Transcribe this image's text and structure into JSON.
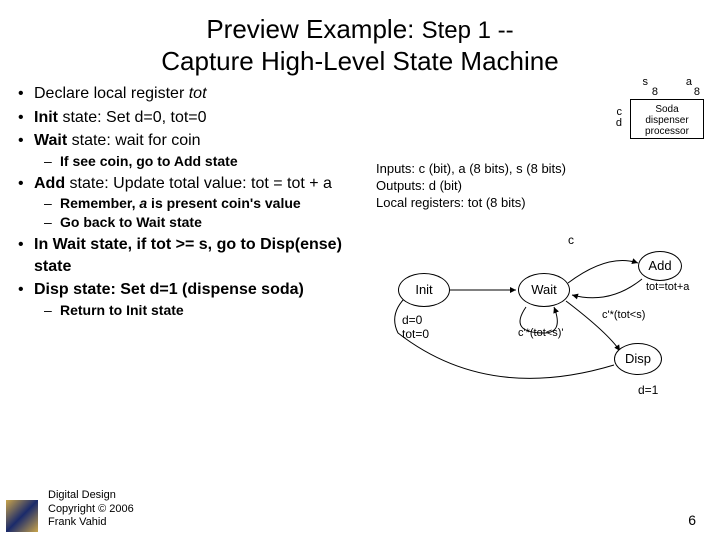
{
  "title_line1_a": "Preview Example: ",
  "title_line1_b": "Step 1 --",
  "title_line2": "Capture High-Level State Machine",
  "bullets": {
    "b1a": "Declare local register ",
    "b1b": "tot",
    "b2a": "Init",
    "b2b": " state: Set d=0, tot=0",
    "b3a": "Wait",
    "b3b": " state: wait for coin",
    "b3s1a": "If see coin, go to ",
    "b3s1b": "Add",
    "b3s1c": " state",
    "b4a": "Add",
    "b4b": " state: Update total value: tot = tot + a",
    "b4s1a": "Remember, ",
    "b4s1b": "a",
    "b4s1c": " is present coin's value",
    "b4s2a": "Go back to ",
    "b4s2b": "Wait",
    "b4s2c": " state",
    "b5a": "In ",
    "b5b": "Wait",
    "b5c": " state, if tot >= s, go to ",
    "b5d": "Disp",
    "b5e": "(ense) state",
    "b6a": "Disp",
    "b6b": " state: Set d=1 (dispense soda)",
    "b6s1a": "Return to ",
    "b6s1b": "Init",
    "b6s1c": " state"
  },
  "proc": {
    "label": "Soda\ndispenser\nprocessor",
    "s": "s",
    "a": "a",
    "c": "c",
    "d": "d",
    "bus": "8"
  },
  "io": {
    "l1": "Inputs: c (bit), a (8 bits), s (8 bits)",
    "l2": "Outputs: d (bit)",
    "l3": "Local registers: tot (8 bits)"
  },
  "fsm": {
    "init": "Init",
    "wait": "Wait",
    "add": "Add",
    "disp": "Disp",
    "c": "c",
    "tot": "tot=tot+a",
    "cprime": "c'*(tot<s)'",
    "cprime2": "c'*(tot<s)",
    "d0a": "d=0",
    "d0b": "tot=0",
    "d1": "d=1"
  },
  "footer": {
    "l1": "Digital Design",
    "l2": "Copyright © 2006",
    "l3": "Frank Vahid"
  },
  "page": "6"
}
